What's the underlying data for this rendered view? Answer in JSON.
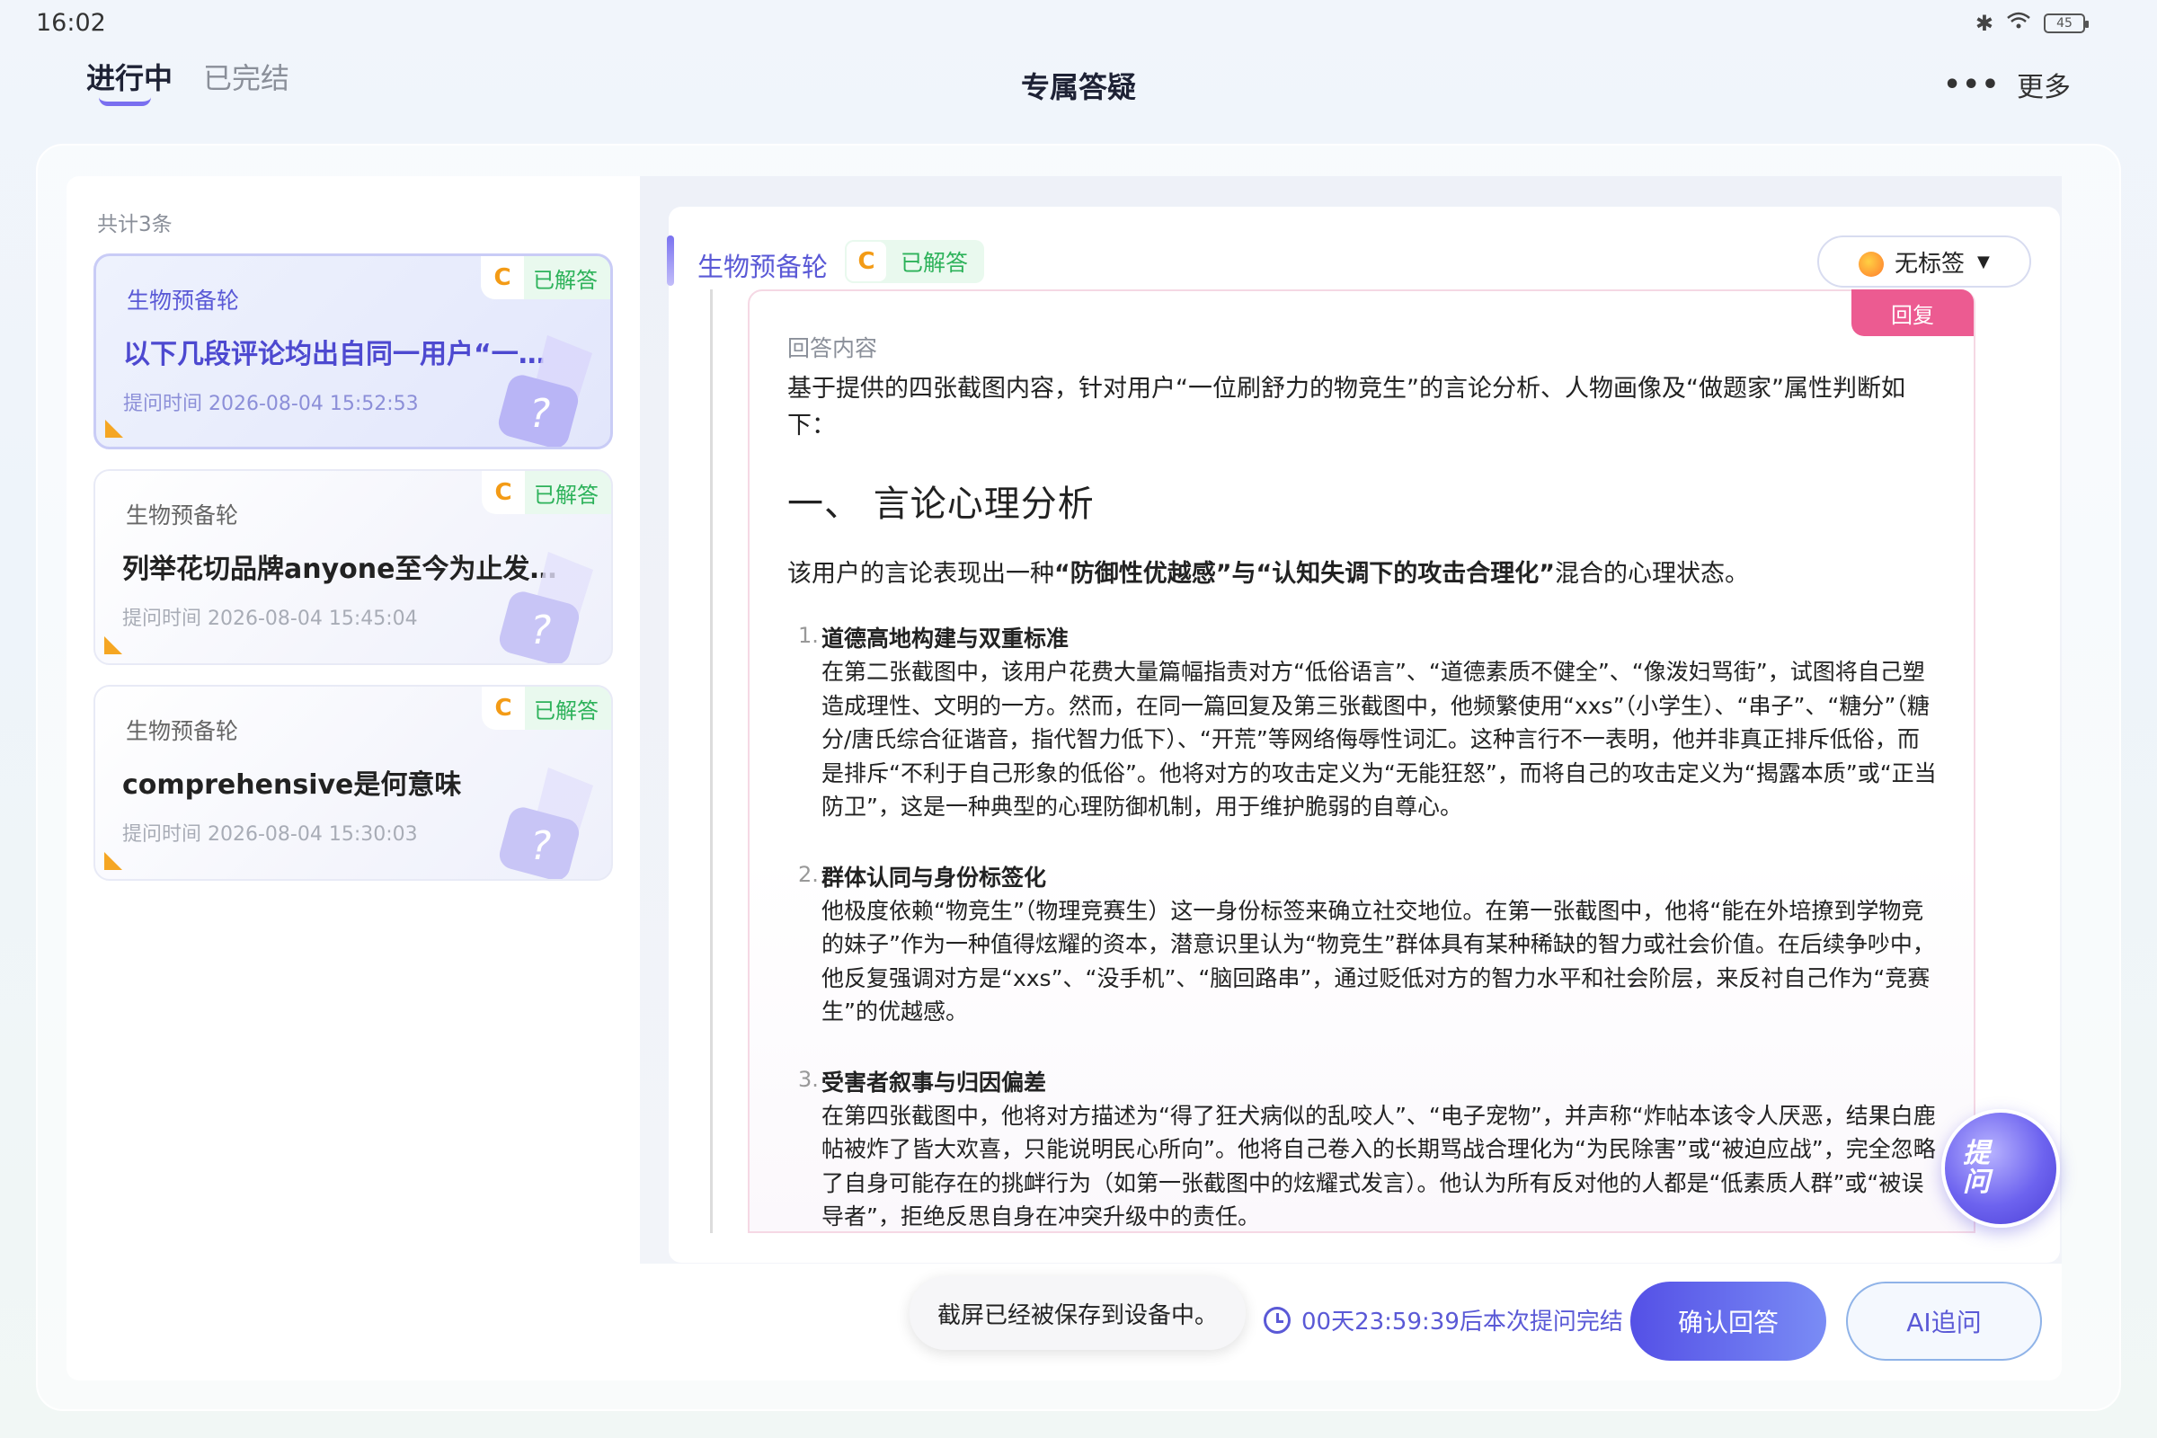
{
  "status_bar": {
    "time": "16:02",
    "battery": "45"
  },
  "nav": {
    "tabs": [
      {
        "label": "进行中",
        "active": true
      },
      {
        "label": "已完结",
        "active": false
      }
    ],
    "title": "专属答疑",
    "more_label": "更多"
  },
  "list": {
    "count_text": "共计3条",
    "items": [
      {
        "subject": "生物预备轮",
        "badge_letter": "C",
        "status": "已解答",
        "title": "以下几段评论均出自同一用户“一位刷舒力的物竞生”",
        "time": "提问时间 2026-08-04 15:52:53"
      },
      {
        "subject": "生物预备轮",
        "badge_letter": "C",
        "status": "已解答",
        "title": "列举花切品牌anyone至今为止发售的所有花切牌",
        "time": "提问时间 2026-08-04 15:45:04"
      },
      {
        "subject": "生物预备轮",
        "badge_letter": "C",
        "status": "已解答",
        "title": "comprehensive是何意味",
        "time": "提问时间 2026-08-04 15:30:03"
      }
    ]
  },
  "detail": {
    "subject": "生物预备轮",
    "badge_letter": "C",
    "status": "已解答",
    "tag_select": "无标签",
    "reply_tag": "回复",
    "answer_label": "回答内容",
    "intro": "基于提供的四张截图内容，针对用户“一位刷舒力的物竞生”的言论分析、人物画像及“做题家”属性判断如下：",
    "section_title": "一、 言论心理分析",
    "section_intro_pre": "该用户的言论表现出一种",
    "section_intro_bold": "“防御性优越感”与“认知失调下的攻击合理化”",
    "section_intro_post": "混合的心理状态。",
    "points": [
      {
        "num": "1.",
        "heading": "道德高地构建与双重标准",
        "body": "在第二张截图中，该用户花费大量篇幅指责对方“低俗语言”、“道德素质不健全”、“像泼妇骂街”，试图将自己塑造成理性、文明的一方。然而，在同一篇回复及第三张截图中，他频繁使用“xxs”（小学生）、“串子”、“糖分”（糖分/唐氏综合征谐音，指代智力低下）、“开荒”等网络侮辱性词汇。这种言行不一表明，他并非真正排斥低俗，而是排斥“不利于自己形象的低俗”。他将对方的攻击定义为“无能狂怒”，而将自己的攻击定义为“揭露本质”或“正当防卫”，这是一种典型的心理防御机制，用于维护脆弱的自尊心。"
      },
      {
        "num": "2.",
        "heading": "群体认同与身份标签化",
        "body": "他极度依赖“物竞生”（物理竞赛生）这一身份标签来确立社交地位。在第一张截图中，他将“能在外培撩到学物竞的妹子”作为一种值得炫耀的资本，潜意识里认为“物竞生”群体具有某种稀缺的智力或社会价值。在后续争吵中，他反复强调对方是“xxs”、“没手机”、“脑回路串”，通过贬低对方的智力水平和社会阶层，来反衬自己作为“竞赛生”的优越感。"
      },
      {
        "num": "3.",
        "heading": "受害者叙事与归因偏差",
        "body": "在第四张截图中，他将对方描述为“得了狂犬病似的乱咬人”、“电子宠物”，并声称“炸帖本该令人厌恶，结果白鹿帖被炸了皆大欢喜，只能说明民心所向”。他将自己卷入的长期骂战合理化为“为民除害”或“被迫应战”，完全忽略了自身可能存在的挑衅行为（如第一张截图中的炫耀式发言）。他认为所有反对他的人都是“低素质人群”或“被误导者”，拒绝反思自身在冲突升级中的责任。"
      }
    ],
    "float_button": "提问"
  },
  "bottom": {
    "toast": "截屏已经被保存到设备中。",
    "countdown": "00天23:59:39后本次提问完结",
    "confirm_button": "确认回答",
    "ai_button": "AI追问"
  }
}
